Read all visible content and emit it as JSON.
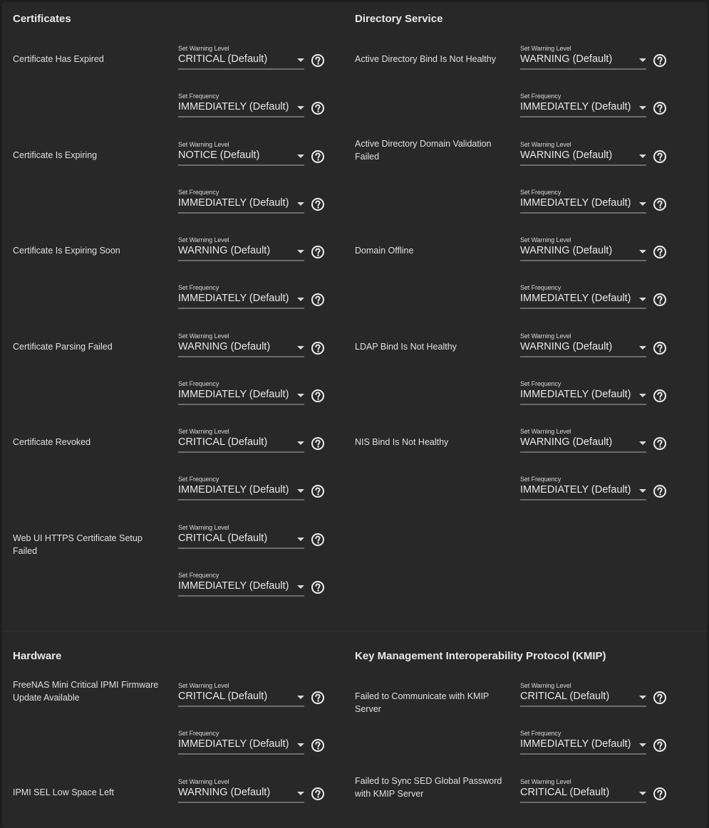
{
  "colors": {
    "page_bg": "#1e1e1e",
    "card_bg": "#282828",
    "text": "#e6e6e6",
    "underline": "#6c6c6c"
  },
  "field_labels": {
    "level": "Set Warning Level",
    "frequency": "Set Frequency"
  },
  "sections": [
    {
      "title": "Certificates",
      "alerts": [
        {
          "name": "Certificate Has Expired",
          "level": "CRITICAL (Default)",
          "frequency": "IMMEDIATELY (Default)"
        },
        {
          "name": "Certificate Is Expiring",
          "level": "NOTICE (Default)",
          "frequency": "IMMEDIATELY (Default)"
        },
        {
          "name": "Certificate Is Expiring Soon",
          "level": "WARNING (Default)",
          "frequency": "IMMEDIATELY (Default)"
        },
        {
          "name": "Certificate Parsing Failed",
          "level": "WARNING (Default)",
          "frequency": "IMMEDIATELY (Default)"
        },
        {
          "name": "Certificate Revoked",
          "level": "CRITICAL (Default)",
          "frequency": "IMMEDIATELY (Default)"
        },
        {
          "name": "Web UI HTTPS Certificate Setup Failed",
          "level": "CRITICAL (Default)",
          "frequency": "IMMEDIATELY (Default)"
        }
      ]
    },
    {
      "title": "Directory Service",
      "alerts": [
        {
          "name": "Active Directory Bind Is Not Healthy",
          "level": "WARNING (Default)",
          "frequency": "IMMEDIATELY (Default)"
        },
        {
          "name": "Active Directory Domain Validation Failed",
          "level": "WARNING (Default)",
          "frequency": "IMMEDIATELY (Default)"
        },
        {
          "name": "Domain Offline",
          "level": "WARNING (Default)",
          "frequency": "IMMEDIATELY (Default)"
        },
        {
          "name": "LDAP Bind Is Not Healthy",
          "level": "WARNING (Default)",
          "frequency": "IMMEDIATELY (Default)"
        },
        {
          "name": "NIS Bind Is Not Healthy",
          "level": "WARNING (Default)",
          "frequency": "IMMEDIATELY (Default)"
        }
      ]
    },
    {
      "title": "Hardware",
      "alerts": [
        {
          "name": "FreeNAS Mini Critical IPMI Firmware Update Available",
          "level": "CRITICAL (Default)",
          "frequency": "IMMEDIATELY (Default)"
        },
        {
          "name": "IPMI SEL Low Space Left",
          "level": "WARNING (Default)",
          "frequency": null
        }
      ]
    },
    {
      "title": "Key Management Interoperability Protocol (KMIP)",
      "alerts": [
        {
          "name": "Failed to Communicate with KMIP Server",
          "level": "CRITICAL (Default)",
          "frequency": "IMMEDIATELY (Default)"
        },
        {
          "name": "Failed to Sync SED Global Password with KMIP Server",
          "level": "CRITICAL (Default)",
          "frequency": null
        }
      ]
    }
  ]
}
